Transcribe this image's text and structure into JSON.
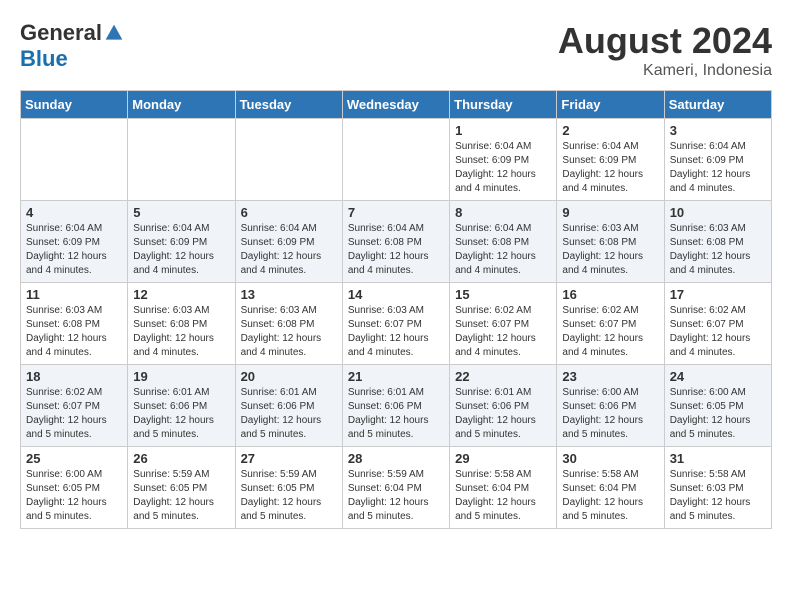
{
  "header": {
    "logo_general": "General",
    "logo_blue": "Blue",
    "month_year": "August 2024",
    "location": "Kameri, Indonesia"
  },
  "weekdays": [
    "Sunday",
    "Monday",
    "Tuesday",
    "Wednesday",
    "Thursday",
    "Friday",
    "Saturday"
  ],
  "weeks": [
    [
      {
        "day": "",
        "info": ""
      },
      {
        "day": "",
        "info": ""
      },
      {
        "day": "",
        "info": ""
      },
      {
        "day": "",
        "info": ""
      },
      {
        "day": "1",
        "info": "Sunrise: 6:04 AM\nSunset: 6:09 PM\nDaylight: 12 hours\nand 4 minutes."
      },
      {
        "day": "2",
        "info": "Sunrise: 6:04 AM\nSunset: 6:09 PM\nDaylight: 12 hours\nand 4 minutes."
      },
      {
        "day": "3",
        "info": "Sunrise: 6:04 AM\nSunset: 6:09 PM\nDaylight: 12 hours\nand 4 minutes."
      }
    ],
    [
      {
        "day": "4",
        "info": "Sunrise: 6:04 AM\nSunset: 6:09 PM\nDaylight: 12 hours\nand 4 minutes."
      },
      {
        "day": "5",
        "info": "Sunrise: 6:04 AM\nSunset: 6:09 PM\nDaylight: 12 hours\nand 4 minutes."
      },
      {
        "day": "6",
        "info": "Sunrise: 6:04 AM\nSunset: 6:09 PM\nDaylight: 12 hours\nand 4 minutes."
      },
      {
        "day": "7",
        "info": "Sunrise: 6:04 AM\nSunset: 6:08 PM\nDaylight: 12 hours\nand 4 minutes."
      },
      {
        "day": "8",
        "info": "Sunrise: 6:04 AM\nSunset: 6:08 PM\nDaylight: 12 hours\nand 4 minutes."
      },
      {
        "day": "9",
        "info": "Sunrise: 6:03 AM\nSunset: 6:08 PM\nDaylight: 12 hours\nand 4 minutes."
      },
      {
        "day": "10",
        "info": "Sunrise: 6:03 AM\nSunset: 6:08 PM\nDaylight: 12 hours\nand 4 minutes."
      }
    ],
    [
      {
        "day": "11",
        "info": "Sunrise: 6:03 AM\nSunset: 6:08 PM\nDaylight: 12 hours\nand 4 minutes."
      },
      {
        "day": "12",
        "info": "Sunrise: 6:03 AM\nSunset: 6:08 PM\nDaylight: 12 hours\nand 4 minutes."
      },
      {
        "day": "13",
        "info": "Sunrise: 6:03 AM\nSunset: 6:08 PM\nDaylight: 12 hours\nand 4 minutes."
      },
      {
        "day": "14",
        "info": "Sunrise: 6:03 AM\nSunset: 6:07 PM\nDaylight: 12 hours\nand 4 minutes."
      },
      {
        "day": "15",
        "info": "Sunrise: 6:02 AM\nSunset: 6:07 PM\nDaylight: 12 hours\nand 4 minutes."
      },
      {
        "day": "16",
        "info": "Sunrise: 6:02 AM\nSunset: 6:07 PM\nDaylight: 12 hours\nand 4 minutes."
      },
      {
        "day": "17",
        "info": "Sunrise: 6:02 AM\nSunset: 6:07 PM\nDaylight: 12 hours\nand 4 minutes."
      }
    ],
    [
      {
        "day": "18",
        "info": "Sunrise: 6:02 AM\nSunset: 6:07 PM\nDaylight: 12 hours\nand 5 minutes."
      },
      {
        "day": "19",
        "info": "Sunrise: 6:01 AM\nSunset: 6:06 PM\nDaylight: 12 hours\nand 5 minutes."
      },
      {
        "day": "20",
        "info": "Sunrise: 6:01 AM\nSunset: 6:06 PM\nDaylight: 12 hours\nand 5 minutes."
      },
      {
        "day": "21",
        "info": "Sunrise: 6:01 AM\nSunset: 6:06 PM\nDaylight: 12 hours\nand 5 minutes."
      },
      {
        "day": "22",
        "info": "Sunrise: 6:01 AM\nSunset: 6:06 PM\nDaylight: 12 hours\nand 5 minutes."
      },
      {
        "day": "23",
        "info": "Sunrise: 6:00 AM\nSunset: 6:06 PM\nDaylight: 12 hours\nand 5 minutes."
      },
      {
        "day": "24",
        "info": "Sunrise: 6:00 AM\nSunset: 6:05 PM\nDaylight: 12 hours\nand 5 minutes."
      }
    ],
    [
      {
        "day": "25",
        "info": "Sunrise: 6:00 AM\nSunset: 6:05 PM\nDaylight: 12 hours\nand 5 minutes."
      },
      {
        "day": "26",
        "info": "Sunrise: 5:59 AM\nSunset: 6:05 PM\nDaylight: 12 hours\nand 5 minutes."
      },
      {
        "day": "27",
        "info": "Sunrise: 5:59 AM\nSunset: 6:05 PM\nDaylight: 12 hours\nand 5 minutes."
      },
      {
        "day": "28",
        "info": "Sunrise: 5:59 AM\nSunset: 6:04 PM\nDaylight: 12 hours\nand 5 minutes."
      },
      {
        "day": "29",
        "info": "Sunrise: 5:58 AM\nSunset: 6:04 PM\nDaylight: 12 hours\nand 5 minutes."
      },
      {
        "day": "30",
        "info": "Sunrise: 5:58 AM\nSunset: 6:04 PM\nDaylight: 12 hours\nand 5 minutes."
      },
      {
        "day": "31",
        "info": "Sunrise: 5:58 AM\nSunset: 6:03 PM\nDaylight: 12 hours\nand 5 minutes."
      }
    ]
  ]
}
